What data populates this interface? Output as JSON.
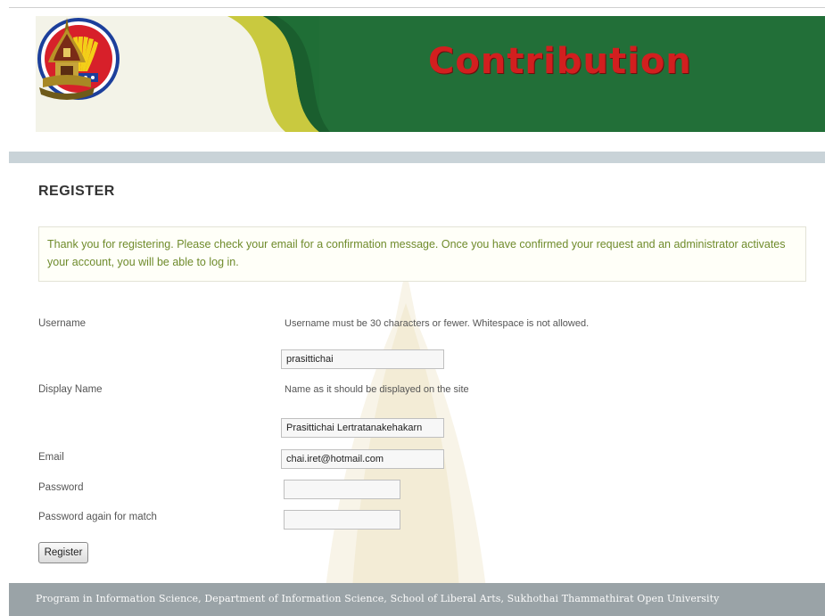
{
  "header": {
    "title": "Contribution"
  },
  "page": {
    "heading": "REGISTER",
    "notice": "Thank you for registering. Please check your email for a confirmation message. Once you have confirmed your request and an administrator activates your account, you will be able to log in."
  },
  "form": {
    "username": {
      "label": "Username",
      "hint": "Username must be 30 characters or fewer. Whitespace is not allowed.",
      "value": "prasittichai"
    },
    "display_name": {
      "label": "Display Name",
      "hint": "Name as it should be displayed on the site",
      "value": "Prasittichai Lertratanakehakarn"
    },
    "email": {
      "label": "Email",
      "value": "chai.iret@hotmail.com"
    },
    "password": {
      "label": "Password",
      "value": ""
    },
    "password_confirm": {
      "label": "Password again for match",
      "value": ""
    },
    "submit_label": "Register"
  },
  "footer": {
    "text": "Program in Information Science, Department of Information Science, School of Liberal Arts, Sukhothai Thammathirat Open University"
  },
  "colors": {
    "banner_green": "#1f6e36",
    "banner_accent": "#c8c43a",
    "title_red": "#d21f1f",
    "notice_text": "#6f8b2c",
    "footer_bg": "#9aa3a7"
  },
  "icons": {
    "left_logo": "asean-emblem-icon",
    "right_logo": "temple-crest-icon"
  }
}
